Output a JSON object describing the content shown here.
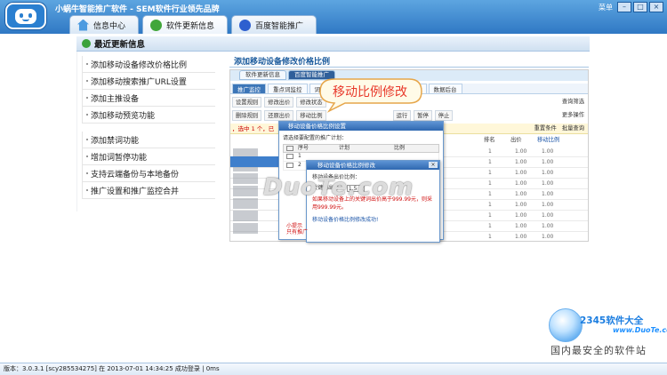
{
  "app": {
    "title": "小蜗牛智能推广软件 - SEM软件行业领先品牌",
    "window_buttons": [
      "菜单",
      "–",
      "□",
      "×"
    ]
  },
  "tabs": [
    {
      "label": "信息中心",
      "icon": "home-icon",
      "active": false
    },
    {
      "label": "软件更新信息",
      "icon": "refresh-icon",
      "active": true
    },
    {
      "label": "百度智能推广",
      "icon": "baidu-icon",
      "active": false
    }
  ],
  "section": {
    "title": "最近更新信息",
    "icon": "refresh-icon"
  },
  "feature_list_a": [
    "添加移动设备修改价格比例",
    "添加移动搜索推广URL设置",
    "添加主推设备",
    "添加移动预览功能"
  ],
  "feature_list_b": [
    "添加禁词功能",
    "增加词暂停功能",
    "支持云端备份与本地备份",
    "推广设置和推广监控合并"
  ],
  "preview": {
    "title": "添加移动设备修改价格比例",
    "screenshot": {
      "top_tabs": [
        "软件更新信息",
        "百度智能推广"
      ],
      "nav": [
        "推广监控",
        "重点词监控",
        "词",
        "置批置",
        "数据后台"
      ],
      "toolbar1": [
        "设置规则",
        "修改出价",
        "修改状态"
      ],
      "toolbar1_right": "查询筛选",
      "toolbar2": [
        "删除规则",
        "还原出价",
        "移动比例"
      ],
      "toolbar2_mid": [
        "运行",
        "暂停",
        "停止"
      ],
      "toolbar2_right": "更多操作",
      "toolbar3_right": [
        "重置条件",
        "批量查询"
      ],
      "selection_text": "，选中 1 个，已",
      "grid_headers": [
        "排名",
        "出价",
        "移动比例"
      ],
      "grid_rows": [
        [
          "1",
          "1.00",
          "1.00"
        ],
        [
          "1",
          "1.00",
          "1.00"
        ],
        [
          "1",
          "1.00",
          "1.00"
        ],
        [
          "1",
          "1.00",
          "1.00"
        ],
        [
          "1",
          "1.00",
          "1.00"
        ],
        [
          "1",
          "1.00",
          "1.00"
        ],
        [
          "1",
          "1.00",
          "1.00"
        ],
        [
          "1",
          "1.00",
          "1.00"
        ],
        [
          "1",
          "1.00",
          "1.00"
        ]
      ],
      "dialog1": {
        "title": "移动设备价格比例设置",
        "subtitle": "请选择要配置的推广计划：",
        "columns": [
          "序号",
          "计划",
          "比例"
        ],
        "rows": [
          "1",
          "2"
        ]
      },
      "dialog2": {
        "title": "移动设备价格比例修改",
        "close": "×",
        "line1": "移动设备出价比例：",
        "field_label": "关键词出价 ×",
        "field_value": "1.5",
        "warning": "如果移动设备上的关键词出价高于999.99元，则采用999.99元。",
        "success": "移动设备价格比例修改成功!"
      },
      "left_red": [
        "小提示",
        "只有推广"
      ]
    },
    "callout": "移动比例修改",
    "watermark": "DuoTe.com"
  },
  "branding": {
    "name": "2345软件大全",
    "site": "www.DuoTe.com",
    "slogan": "国内最安全的软件站"
  },
  "statusbar": "版本：3.0.3.1 [scy285534275] 在 2013-07-01 14:34:25 成功登录 | 0ms",
  "colors": {
    "titlebar_top": "#5da5e0",
    "titlebar_bottom": "#2f78c4",
    "accent_red": "#e8382a",
    "link_blue": "#1a5a9c"
  }
}
